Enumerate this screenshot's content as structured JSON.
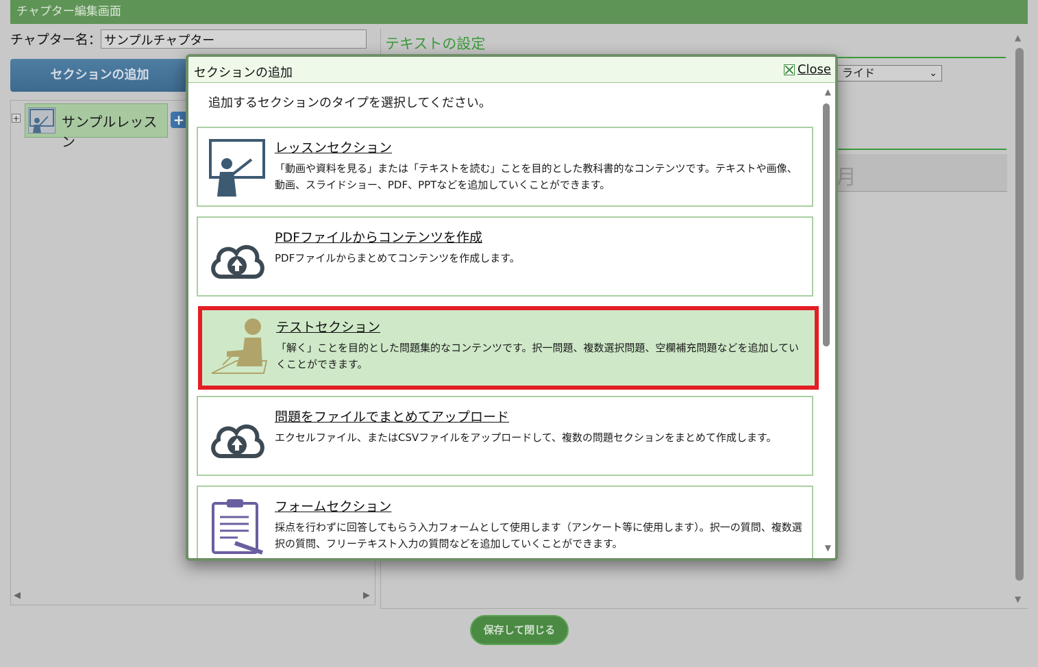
{
  "page": {
    "title": "チャプター編集画面",
    "chapter_name_label": "チャプター名：",
    "chapter_name_value": "サンプルチャプター",
    "add_section_button": "セクションの追加",
    "tree_node_label": "サンプルレッスン",
    "text_settings_title": "テキストの設定",
    "slide_select_value": "ライド",
    "save_close_button": "保存して閉じる"
  },
  "modal": {
    "title": "セクションの追加",
    "close_label": "Close",
    "instruction": "追加するセクションのタイプを選択してください。",
    "selected_index": 2,
    "cards": [
      {
        "icon": "teacher-board-icon",
        "title": "レッスンセクション",
        "description": "「動画や資料を見る」または「テキストを読む」ことを目的とした教科書的なコンテンツです。テキストや画像、動画、スライドショー、PDF、PPTなどを追加していくことができます。"
      },
      {
        "icon": "cloud-upload-icon",
        "title": "PDFファイルからコンテンツを作成",
        "description": "PDFファイルからまとめてコンテンツを作成します。"
      },
      {
        "icon": "student-writing-icon",
        "title": "テストセクション",
        "description": "「解く」ことを目的とした問題集的なコンテンツです。択一問題、複数選択問題、空欄補充問題などを追加していくことができます。"
      },
      {
        "icon": "cloud-upload-icon",
        "title": "問題をファイルでまとめてアップロード",
        "description": "エクセルファイル、またはCSVファイルをアップロードして、複数の問題セクションをまとめて作成します。"
      },
      {
        "icon": "clipboard-form-icon",
        "title": "フォームセクション",
        "description": "採点を行わずに回答してもらう入力フォームとして使用します（アンケート等に使用します）。択一の質問、複数選択の質問、フリーテキスト入力の質問などを追加していくことができます。"
      }
    ]
  },
  "colors": {
    "title_bar": "#5f9457",
    "accent_green": "#3a9a3a",
    "selection_border": "#e31e24",
    "selected_card_bg": "#cfe9c8"
  }
}
